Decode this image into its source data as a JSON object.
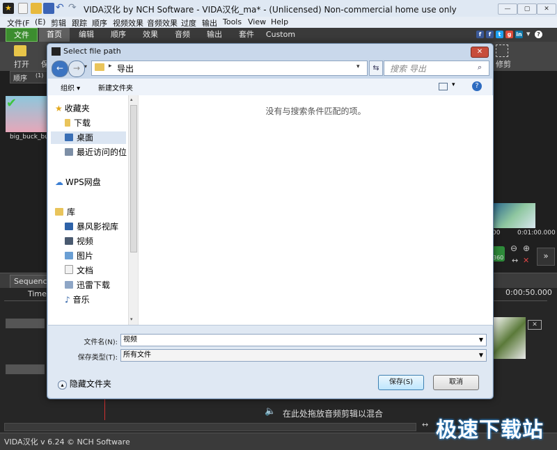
{
  "app": {
    "title": "VIDA汉化 by NCH Software - VIDA汉化_ma* - (Unlicensed) Non-commercial home use only",
    "menu": [
      "文件(F",
      "(E)",
      "剪辑",
      "跟踪",
      "顺序",
      "视频效果",
      "音频效果",
      "过度",
      "输出",
      "Tools",
      "View",
      "Help"
    ],
    "ribbon_tabs": [
      "文件",
      "首页",
      "编辑",
      "顺序",
      "效果",
      "音频",
      "输出",
      "套件",
      "Custom"
    ],
    "toolbar": {
      "open_label": "打开",
      "save_label": "保",
      "trim_label": "修剪"
    },
    "left_panel": {
      "tab": "顺序",
      "tab_count": "(1)",
      "clip_name": "big_buck_bun"
    },
    "right_panel": {
      "time_start": "00",
      "time_end": "0:01:00.000",
      "badge": "360"
    },
    "sequence_tab": "Sequence",
    "timeline": {
      "time_label": "Time",
      "time_marker": "0:00:50.000",
      "audio_drop_hint": "在此处拖放音频剪辑以混合"
    },
    "status": "VIDA汉化 v 6.24 © NCH Software",
    "watermark": "极速下载站",
    "colors": {
      "file_tab": "#3c8d2f",
      "dialog_frame": "#c9d8eb",
      "accent": "#3c7fb1"
    }
  },
  "dialog": {
    "title": "Select file path",
    "close_label": "✕",
    "address": {
      "folder": "导出"
    },
    "search_placeholder": "搜索 导出",
    "cmd": {
      "organize": "组织 ▾",
      "new_folder": "新建文件夹"
    },
    "nav": {
      "favorites": "收藏夹",
      "downloads": "下载",
      "desktop": "桌面",
      "recent": "最近访问的位",
      "wps": "WPS网盘",
      "libraries": "库",
      "storm": "暴风影视库",
      "videos": "视频",
      "pictures": "图片",
      "documents": "文档",
      "thunder": "迅雷下载",
      "music": "音乐"
    },
    "empty_message": "没有与搜索条件匹配的项。",
    "filename_label": "文件名(N):",
    "filename_value": "视频",
    "filetype_label": "保存类型(T):",
    "filetype_value": "所有文件",
    "hide_folders": "隐藏文件夹",
    "save_button": "保存(S)",
    "cancel_button": "取消"
  }
}
